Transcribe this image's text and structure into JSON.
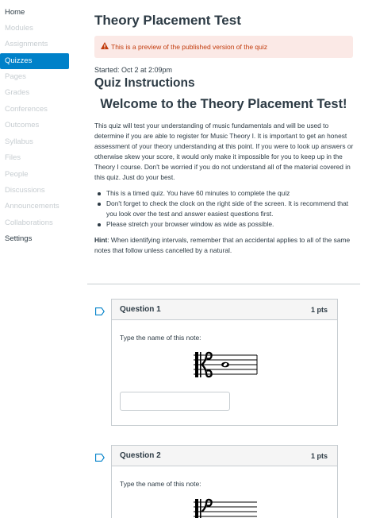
{
  "sidebar": {
    "items": [
      {
        "label": "Home"
      },
      {
        "label": "Modules"
      },
      {
        "label": "Assignments"
      },
      {
        "label": "Quizzes"
      },
      {
        "label": "Pages"
      },
      {
        "label": "Grades"
      },
      {
        "label": "Conferences"
      },
      {
        "label": "Outcomes"
      },
      {
        "label": "Syllabus"
      },
      {
        "label": "Files"
      },
      {
        "label": "People"
      },
      {
        "label": "Discussions"
      },
      {
        "label": "Announcements"
      },
      {
        "label": "Collaborations"
      },
      {
        "label": "Settings"
      }
    ],
    "active": "Quizzes"
  },
  "quiz": {
    "title": "Theory Placement Test",
    "preview_alert": "This is a preview of the published version of the quiz",
    "started": "Started: Oct 2 at 2:09pm",
    "instructions_heading": "Quiz Instructions",
    "welcome": "Welcome to the Theory Placement Test!",
    "paragraph": "This quiz will test your understanding of music fundamentals and will be used to determine if you are able to register for Music Theory I.    It is important to get an honest assessment of your theory understanding at this point.  If you were to look up answers or otherwise skew your score, it would only make it impossible for you to keep up in the Theory I course. Don't be worried if you do not understand all of the material covered in this quiz.  Just do your best.",
    "bullets": [
      "This is a timed quiz.  You have 60 minutes to complete the quiz",
      "Don't forget to check the clock on the right side of the screen.  It is recommend that you look over the test and answer easiest questions first.",
      "Please stretch your browser window as wide as possible."
    ],
    "hint_label": "Hint",
    "hint_text": ":  When identifying intervals, remember that an accidental applies to all of the same notes that follow unless cancelled by a natural."
  },
  "questions": [
    {
      "title": "Question 1",
      "points": "1 pts",
      "prompt": "Type the name of this note:",
      "answer_value": ""
    },
    {
      "title": "Question 2",
      "points": "1 pts",
      "prompt": "Type the name of this note:"
    }
  ],
  "colors": {
    "accent": "#0081c9",
    "alert_text": "#c23c0d",
    "alert_bg": "#fbe9e6",
    "text": "#2d3b45",
    "disabled_nav": "#c7cdd1"
  },
  "icons": {
    "alert": "warning-icon",
    "question_flag": "flag-outline-icon",
    "music": "alto-clef-icon"
  }
}
